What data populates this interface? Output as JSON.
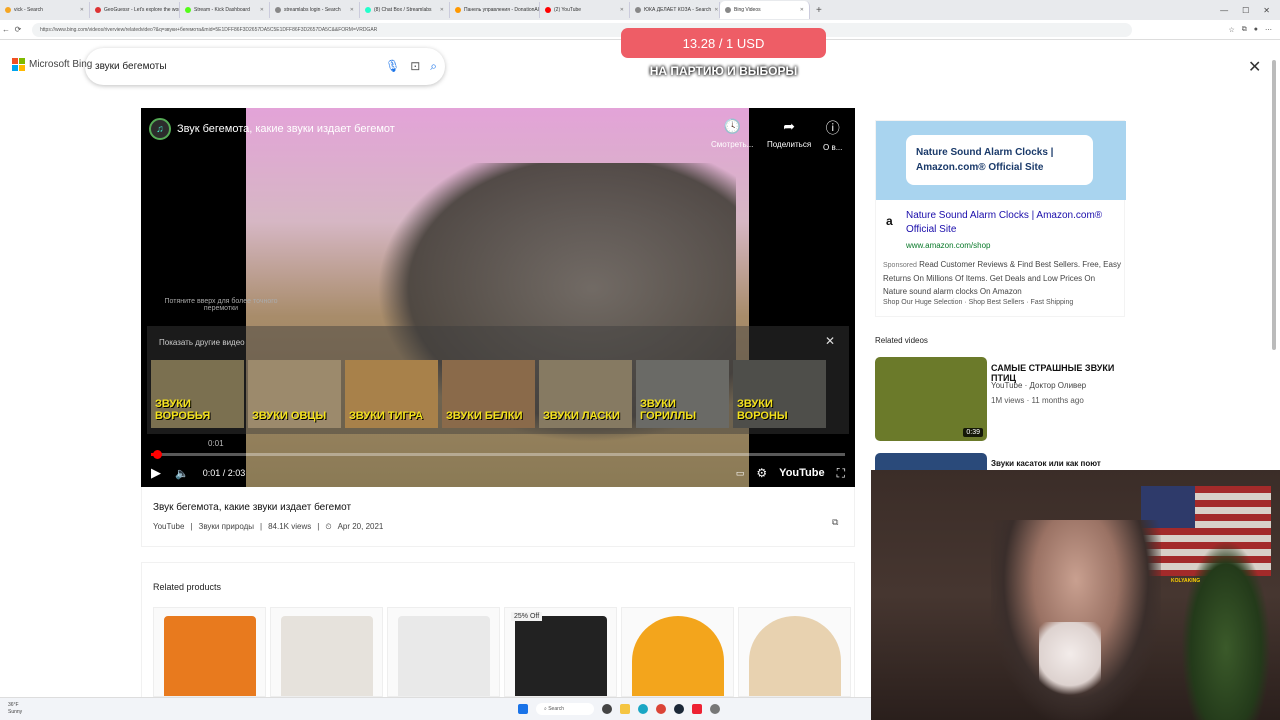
{
  "browser": {
    "tabs": [
      {
        "label": "vick - Search",
        "color": "#f5a623"
      },
      {
        "label": "GeoGuessr - Let's explore the world!",
        "color": "#d33"
      },
      {
        "label": "Stream - Kick Dashboard",
        "color": "#53fc18"
      },
      {
        "label": "streamlabs login - Search",
        "color": "#888"
      },
      {
        "label": "(8) Chat Box / Streamlabs",
        "color": "#2fc"
      },
      {
        "label": "Панель управления - DonationAlerts",
        "color": "#f90"
      },
      {
        "label": "(2) YouTube",
        "color": "#f00"
      },
      {
        "label": "ЮКА ДЕЛАЕТ КОЗА - Search",
        "color": "#888"
      },
      {
        "label": "Bing Videos",
        "color": "#888"
      }
    ],
    "new_tab": "+",
    "url": "https://www.bing.com/videos/riverview/relatedvideo?&q=звуки+бегемота&mid=5E1DFF86F3D2657DA5C5E1DFF86F3D2657DA5C&&FORM=VRDGAR"
  },
  "overlay": {
    "donation_amount": "13.28 / 1 USD",
    "donation_subtitle": "НА ПАРТИЮ И ВЫБОРЫ"
  },
  "header": {
    "logo_text": "Microsoft Bing",
    "search_value": "звуки бегемоты",
    "close_label": "✕"
  },
  "player": {
    "title": "Звук бегемота, какие звуки издает бегемот",
    "watch_later": "Смотреть...",
    "share": "Поделиться",
    "info": "О в...",
    "pull_up_hint": "Потяните вверх для более точного перемотки",
    "more_videos": "Показать другие видео",
    "hover_time": "0:01",
    "time": "0:01 / 2:03",
    "progress_fraction": 0.008,
    "youtube_logo": "YouTube",
    "suggestions": [
      {
        "label": "ЗВУКИ ВОРОБЬЯ",
        "color": "#7b7050"
      },
      {
        "label": "ЗВУКИ ОВЦЫ",
        "color": "#9c8a6c"
      },
      {
        "label": "ЗВУКИ ТИГРА",
        "color": "#a8814a"
      },
      {
        "label": "ЗВУКИ БЕЛКИ",
        "color": "#8a6a4a"
      },
      {
        "label": "ЗВУКИ ЛАСКИ",
        "color": "#867a62"
      },
      {
        "label": "ЗВУКИ ГОРИЛЛЫ",
        "color": "#6a6a66"
      },
      {
        "label": "ЗВУКИ ВОРОНЫ",
        "color": "#4e4e4a"
      }
    ]
  },
  "video_info": {
    "title": "Звук бегемота, какие звуки издает бегемот",
    "source": "YouTube",
    "channel": "Звуки природы",
    "views": "84.1K views",
    "date": "Apr 20, 2021",
    "sep": "|"
  },
  "related_products": {
    "heading": "Related products",
    "items": [
      {
        "badge": "",
        "color": "#e87a1e"
      },
      {
        "badge": "",
        "color": "#e6e2dc"
      },
      {
        "badge": "",
        "color": "#e9e9e9"
      },
      {
        "badge": "25% Off",
        "color": "#222222"
      },
      {
        "badge": "",
        "color": "#f3a51c"
      },
      {
        "badge": "",
        "color": "#e8d2b0"
      }
    ]
  },
  "ad": {
    "banner_text": "Nature Sound Alarm Clocks | Amazon.com® Official Site",
    "logo": "a",
    "link": "Nature Sound Alarm Clocks | Amazon.com® Official Site",
    "url": "www.amazon.com/shop",
    "sponsored": "Sponsored",
    "description": "Read Customer Reviews & Find Best Sellers. Free, Easy Returns On Millions Of Items. Get Deals and Low Prices On Nature sound alarm clocks On Amazon",
    "sitelinks": "Shop Our Huge Selection · Shop Best Sellers · Fast Shipping"
  },
  "related_videos": {
    "heading": "Related videos",
    "items": [
      {
        "title": "САМЫЕ СТРАШНЫЕ ЗВУКИ ПТИЦ",
        "meta": "YouTube · Доктор Оливер",
        "meta2": "1M views · 11 months ago",
        "duration": "0:39",
        "color": "#6b7a2a"
      },
      {
        "title": "Звуки касаток или как поют",
        "meta": "",
        "meta2": "",
        "duration": "",
        "color": "#2a4a7a"
      }
    ]
  },
  "webcam": {
    "neon_text": "KOLYAKING"
  },
  "taskbar": {
    "weather_temp": "36°F",
    "weather_desc": "Sunny",
    "search_label": "Search"
  }
}
